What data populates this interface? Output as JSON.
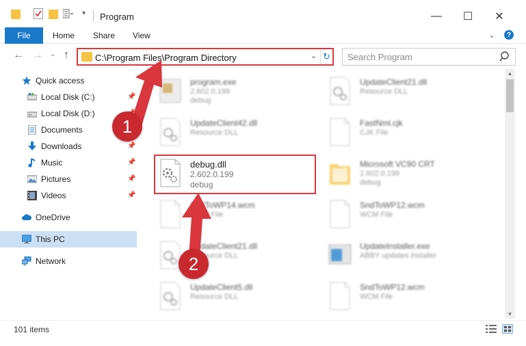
{
  "window": {
    "title": "Program",
    "controls": {
      "minimize": "—",
      "maximize": "☐",
      "close": "✕"
    }
  },
  "ribbon": {
    "file_tab": "File",
    "tabs": [
      "Home",
      "Share",
      "View"
    ],
    "expand_glyph": "⌄",
    "help_glyph": "?"
  },
  "navigation": {
    "back_glyph": "←",
    "forward_glyph": "→",
    "recent_glyph": "⌄",
    "up_glyph": "↑",
    "address_path": "C:\\Program Files\\Program Directory",
    "dropdown_glyph": "⌄",
    "refresh_glyph": "↻",
    "search_placeholder": "Search Program"
  },
  "sidebar": {
    "items": [
      {
        "label": "Quick access",
        "icon": "star-icon",
        "pinned": false
      },
      {
        "label": "Local Disk (C:)",
        "icon": "drive-icon",
        "pinned": true
      },
      {
        "label": "Local Disk (D:)",
        "icon": "drive-icon",
        "pinned": true
      },
      {
        "label": "Documents",
        "icon": "documents-icon",
        "pinned": true
      },
      {
        "label": "Downloads",
        "icon": "download-icon",
        "pinned": true
      },
      {
        "label": "Music",
        "icon": "music-icon",
        "pinned": true
      },
      {
        "label": "Pictures",
        "icon": "pictures-icon",
        "pinned": true
      },
      {
        "label": "Videos",
        "icon": "videos-icon",
        "pinned": true
      },
      {
        "label": "OneDrive",
        "icon": "cloud-icon",
        "pinned": false
      },
      {
        "label": "This PC",
        "icon": "monitor-icon",
        "pinned": false,
        "selected": true
      },
      {
        "label": "Network",
        "icon": "network-icon",
        "pinned": false
      }
    ],
    "pin_glyph": "📌"
  },
  "files": {
    "items": [
      {
        "name": "program.exe",
        "line2": "2.602.0.199",
        "line3": "debug",
        "icon": "exe-icon",
        "blurred": true
      },
      {
        "name": "UpdateClient21.dll",
        "line2": "Resource DLL",
        "line3": "",
        "icon": "dll-icon",
        "blurred": true
      },
      {
        "name": "UpdateClient42.dll",
        "line2": "Resource DLL",
        "line3": "",
        "icon": "dll-icon",
        "blurred": true
      },
      {
        "name": "FastNml.cjk",
        "line2": "CJK File",
        "line3": "",
        "icon": "file-icon",
        "blurred": true
      },
      {
        "name": "debug.dll",
        "line2": "2.602.0.199",
        "line3": "debug",
        "icon": "dll-icon",
        "blurred": false,
        "highlighted": true
      },
      {
        "name": "Microsoft VC90 CRT",
        "line2": "2.602.0.199",
        "line3": "debug",
        "icon": "folder-icon",
        "blurred": true
      },
      {
        "name": "SndToWP14.wcm",
        "line2": "WCM File",
        "line3": "",
        "icon": "file-icon",
        "blurred": true
      },
      {
        "name": "SndToWP12.wcm",
        "line2": "WCM File",
        "line3": "",
        "icon": "file-icon",
        "blurred": true
      },
      {
        "name": "UpdateClient21.dll",
        "line2": "Resource DLL",
        "line3": "",
        "icon": "dll-icon",
        "blurred": true
      },
      {
        "name": "UpdateInstaller.exe",
        "line2": "ABBY updates installer",
        "line3": "",
        "icon": "installer-icon",
        "blurred": true
      },
      {
        "name": "UpdateClient5.dll",
        "line2": "Resource DLL",
        "line3": "",
        "icon": "dll-icon",
        "blurred": true
      },
      {
        "name": "SndToWP12.wcm",
        "line2": "WCM File",
        "line3": "",
        "icon": "file-icon",
        "blurred": true
      }
    ]
  },
  "status": {
    "item_count": "101 items"
  },
  "annotations": {
    "marker_1": "1",
    "marker_2": "2",
    "color": "#d9363e"
  },
  "colors": {
    "accent": "#1979ca",
    "selection": "#cce0f5",
    "folder": "#f6c344"
  }
}
